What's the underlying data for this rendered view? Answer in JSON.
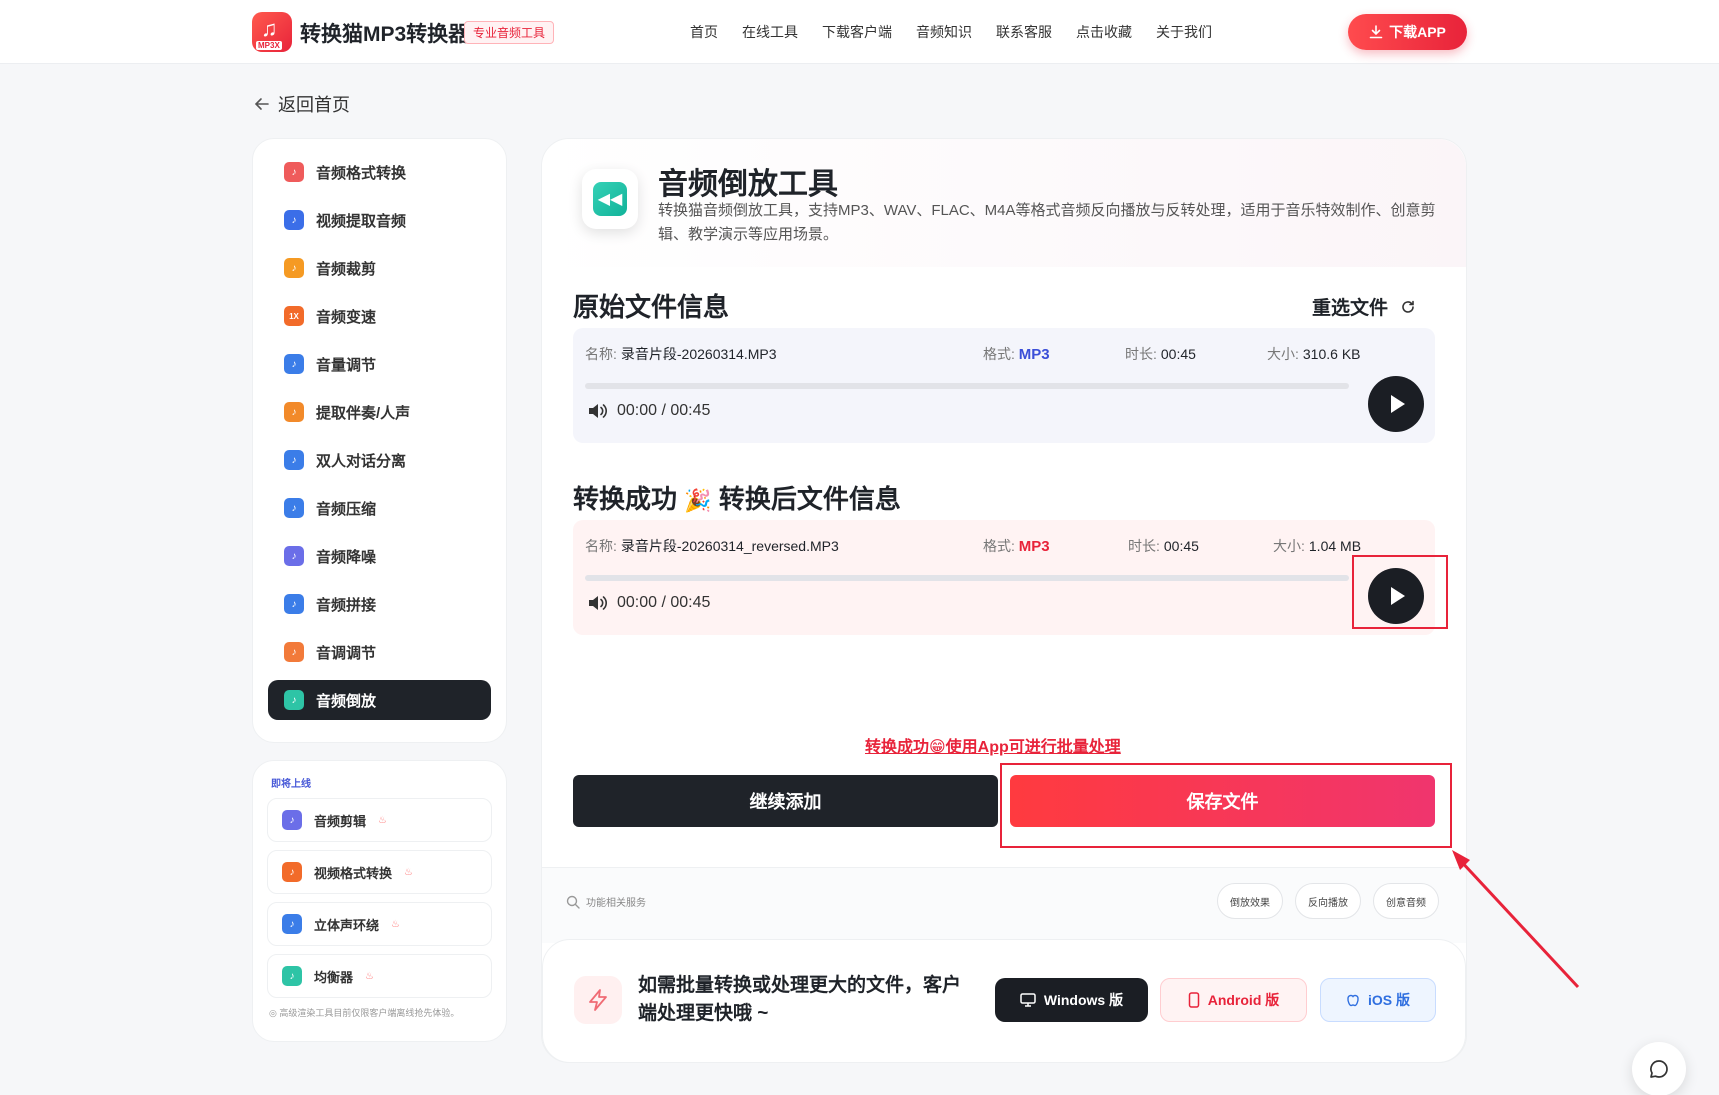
{
  "header": {
    "brand": "转换猫MP3转换器",
    "logo_badge": "MP3X",
    "tag": "专业音频工具",
    "nav": [
      "首页",
      "在线工具",
      "下载客户端",
      "音频知识",
      "联系客服",
      "点击收藏",
      "关于我们"
    ],
    "download_label": "下载APP"
  },
  "back_label": "返回首页",
  "sidebar": {
    "items": [
      {
        "label": "音频格式转换",
        "color": "#ef5b5b"
      },
      {
        "label": "视频提取音频",
        "color": "#3b6ee8"
      },
      {
        "label": "音频裁剪",
        "color": "#f59a23"
      },
      {
        "label": "音频变速",
        "color": "#f26b2a",
        "badge": "1X"
      },
      {
        "label": "音量调节",
        "color": "#3b7de8"
      },
      {
        "label": "提取伴奏/人声",
        "color": "#f28a2a"
      },
      {
        "label": "双人对话分离",
        "color": "#3b7de8"
      },
      {
        "label": "音频压缩",
        "color": "#3b7de8"
      },
      {
        "label": "音频降噪",
        "color": "#6b6ee8"
      },
      {
        "label": "音频拼接",
        "color": "#3b7de8"
      },
      {
        "label": "音调调节",
        "color": "#f27a3a"
      },
      {
        "label": "音频倒放",
        "color": "#2ec4a6"
      }
    ],
    "active_index": 11
  },
  "coming_soon": {
    "title": "即将上线",
    "items": [
      {
        "label": "音频剪辑",
        "color": "#6b6ee8"
      },
      {
        "label": "视频格式转换",
        "color": "#f26b2a"
      },
      {
        "label": "立体声环绕",
        "color": "#3b7de8"
      },
      {
        "label": "均衡器",
        "color": "#2ec4a6"
      }
    ],
    "note": "高级渲染工具目前仅限客户端离线抢先体验。"
  },
  "tool": {
    "title": "音频倒放工具",
    "description": "转换猫音频倒放工具，支持MP3、WAV、FLAC、M4A等格式音频反向播放与反转处理，适用于音乐特效制作、创意剪辑、教学演示等应用场景。"
  },
  "original": {
    "section_title": "原始文件信息",
    "reselect_label": "重选文件",
    "name_label": "名称:",
    "name": "录音片段-20260314.MP3",
    "format_label": "格式:",
    "format": "MP3",
    "duration_label": "时长:",
    "duration": "00:45",
    "size_label": "大小:",
    "size": "310.6 KB",
    "time": "00:00 / 00:45",
    "progress": 0
  },
  "converted": {
    "section_title_success": "转换成功",
    "section_emoji": "🎉",
    "section_title": "转换后文件信息",
    "name_label": "名称:",
    "name": "录音片段-20260314_reversed.MP3",
    "format_label": "格式:",
    "format": "MP3",
    "duration_label": "时长:",
    "duration": "00:45",
    "size_label": "大小:",
    "size": "1.04 MB",
    "time": "00:00 / 00:45",
    "progress": 0
  },
  "batch_link": "转换成功😁使用App可进行批量处理",
  "actions": {
    "continue_label": "继续添加",
    "save_label": "保存文件"
  },
  "services": {
    "label": "功能相关服务",
    "chips": [
      "倒放效果",
      "反向播放",
      "创意音频"
    ]
  },
  "promo": {
    "text": "如需批量转换或处理更大的文件，客户端处理更快哦 ~",
    "windows_label": "Windows 版",
    "android_label": "Android 版",
    "ios_label": "iOS 版"
  },
  "annotation_color": "#e8233a"
}
